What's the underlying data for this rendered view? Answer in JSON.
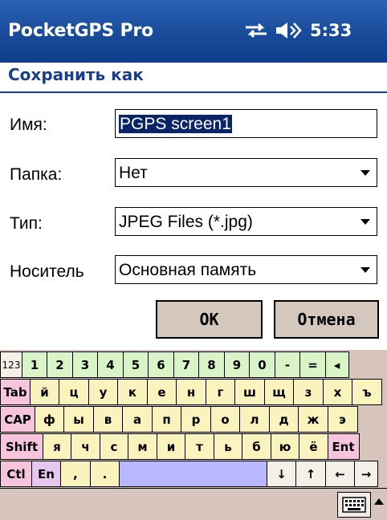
{
  "titlebar": {
    "app_title": "PocketGPS Pro",
    "time": "5:33"
  },
  "header": {
    "title": "Сохранить как"
  },
  "form": {
    "name_label": "Имя:",
    "name_value": "PGPS screen1",
    "folder_label": "Папка:",
    "folder_value": "Нет",
    "type_label": "Тип:",
    "type_value": "JPEG Files (*.jpg)",
    "storage_label": "Носитель",
    "storage_value": "Основная память"
  },
  "buttons": {
    "ok": "OK",
    "cancel": "Отмена"
  },
  "keyboard": {
    "row1": [
      "123",
      "1",
      "2",
      "3",
      "4",
      "5",
      "6",
      "7",
      "8",
      "9",
      "0",
      "-",
      "=",
      "◂"
    ],
    "row2": [
      "Tab",
      "й",
      "ц",
      "у",
      "к",
      "е",
      "н",
      "г",
      "ш",
      "щ",
      "з",
      "х",
      "ъ"
    ],
    "row3": [
      "CAP",
      "ф",
      "ы",
      "в",
      "а",
      "п",
      "р",
      "о",
      "л",
      "д",
      "ж",
      "э"
    ],
    "row4": [
      "Shift",
      "я",
      "ч",
      "с",
      "м",
      "и",
      "т",
      "ь",
      "б",
      "ю",
      "ё",
      "Ent"
    ],
    "row5": [
      "Ctl",
      "En",
      ",",
      ".",
      "",
      "↓",
      "↑",
      "←",
      "→"
    ]
  }
}
